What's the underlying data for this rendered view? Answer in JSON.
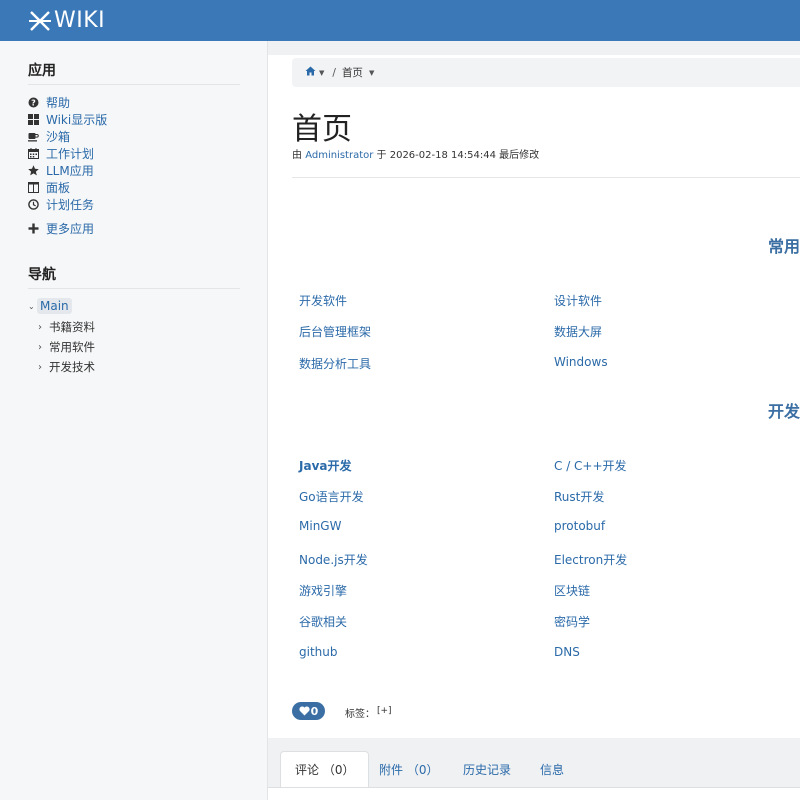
{
  "brand": {
    "logo_text": "WIKI"
  },
  "sidebar": {
    "apps_title": "应用",
    "apps": [
      {
        "label": "帮助",
        "icon": "question-circle-icon"
      },
      {
        "label": "Wiki显示版",
        "icon": "grid-icon"
      },
      {
        "label": "沙箱",
        "icon": "coffee-icon"
      },
      {
        "label": "工作计划",
        "icon": "calendar-icon"
      },
      {
        "label": "LLM应用",
        "icon": "star-icon"
      },
      {
        "label": "面板",
        "icon": "columns-icon"
      },
      {
        "label": "计划任务",
        "icon": "clock-icon"
      }
    ],
    "more_apps": "更多应用",
    "nav_title": "导航",
    "nav_root": "Main",
    "nav_children": [
      "书籍资料",
      "常用软件",
      "开发技术"
    ]
  },
  "breadcrumb": {
    "current": "首页"
  },
  "page": {
    "title": "首页",
    "meta_prefix": "由",
    "meta_author": "Administrator",
    "meta_mid": "于 2026-02-18 14:54:44 最后修改"
  },
  "sections": [
    {
      "heading": "常用"
    },
    {
      "heading": "开发"
    }
  ],
  "links_common": [
    "开发软件",
    "设计软件",
    "后台管理框架",
    "数据大屏",
    "数据分析工具",
    "Windows"
  ],
  "links_dev": [
    "Java开发",
    "C / C++开发",
    "Go语言开发",
    "Rust开发",
    "MinGW",
    "protobuf",
    "Node.js开发",
    "Electron开发",
    "游戏引擎",
    "区块链",
    "谷歌相关",
    "密码学",
    "github",
    "DNS"
  ],
  "footer": {
    "like_count": "0",
    "tags_label": "标签：",
    "tags_add": "[+]"
  },
  "tabs": [
    {
      "label": "评论 （0）"
    },
    {
      "label": "附件 （0）"
    },
    {
      "label": "历史记录"
    },
    {
      "label": "信息"
    }
  ],
  "colors": {
    "accent": "#3b78b8",
    "link": "#2b6aa9"
  }
}
